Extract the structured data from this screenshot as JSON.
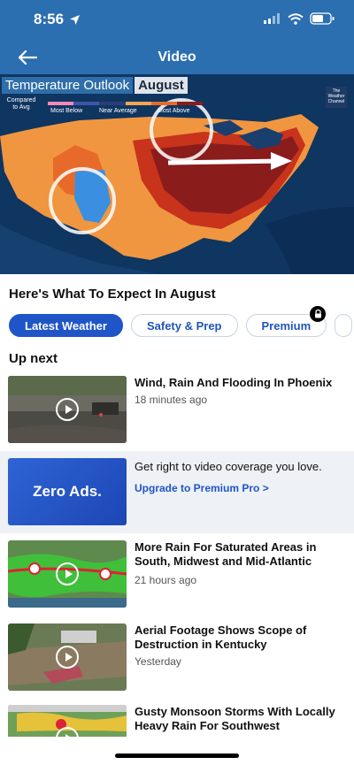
{
  "status": {
    "time": "8:56"
  },
  "nav": {
    "title": "Video"
  },
  "video": {
    "title_main": "Temperature Outlook",
    "title_month": "August",
    "legend_compared": "Compared to Avg",
    "legend_most_below": "Most Below",
    "legend_near_average": "Near Average",
    "legend_most_above": "Most Above",
    "logo_text": "The Weather Channel",
    "colors": {
      "most_below": "#f08ab8",
      "below": "#3d56a8",
      "near": "#2c3d78",
      "above": "#f4a552",
      "most_above": "#8a1c1c"
    }
  },
  "section": {
    "title": "Here's What To Expect In August"
  },
  "chips": [
    "Latest Weather",
    "Safety & Prep",
    "Premium"
  ],
  "up_next": {
    "label": "Up next"
  },
  "videos": [
    {
      "title": "Wind, Rain And Flooding In Phoenix",
      "meta": "18 minutes ago"
    },
    {
      "title": "More Rain For Saturated Areas in South, Midwest and Mid-Atlantic",
      "meta": "21 hours ago"
    },
    {
      "title": "Aerial Footage Shows Scope of Destruction in Kentucky",
      "meta": "Yesterday"
    },
    {
      "title": "Gusty Monsoon Storms With Locally Heavy Rain For Southwest",
      "meta": ""
    }
  ],
  "ad": {
    "thumb_text": "Zero Ads.",
    "text": "Get right to video coverage you love.",
    "link": "Upgrade to Premium Pro >"
  }
}
